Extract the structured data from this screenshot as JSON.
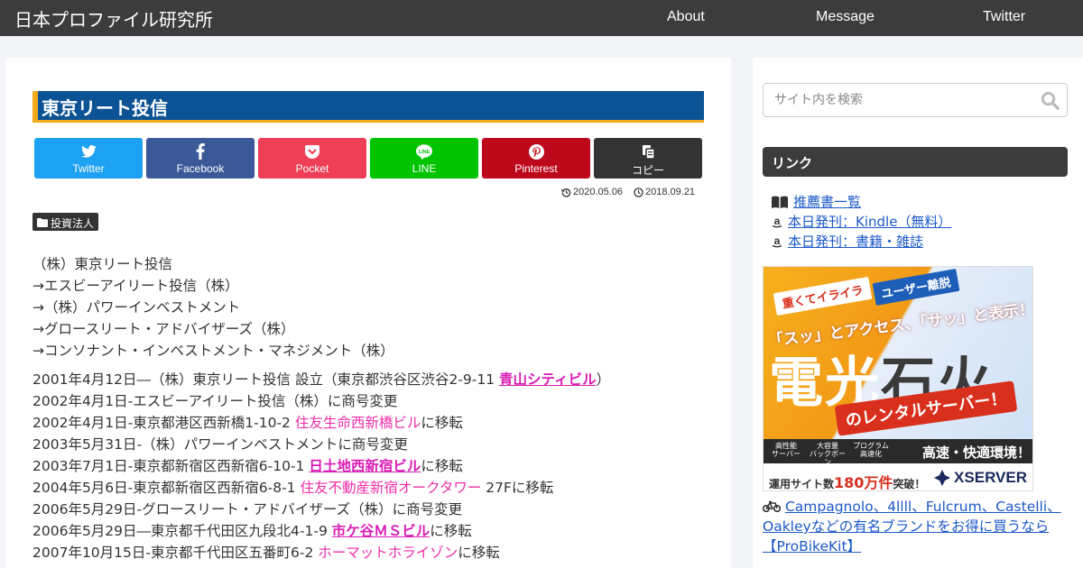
{
  "header": {
    "site_title": "日本プロファイル研究所",
    "nav": [
      "About",
      "Message",
      "Twitter"
    ]
  },
  "article": {
    "title": "東京リート投信",
    "share_buttons": [
      {
        "label": "Twitter",
        "color": "#1da1f2",
        "icon": "twitter-icon"
      },
      {
        "label": "Facebook",
        "color": "#3b5998",
        "icon": "facebook-icon"
      },
      {
        "label": "Pocket",
        "color": "#ef3f56",
        "icon": "pocket-icon"
      },
      {
        "label": "LINE",
        "color": "#00c300",
        "icon": "line-icon"
      },
      {
        "label": "Pinterest",
        "color": "#bd081c",
        "icon": "pinterest-icon"
      },
      {
        "label": "コピー",
        "color": "#333333",
        "icon": "copy-icon"
      }
    ],
    "updated_date": "2020.05.06",
    "published_date": "2018.09.21",
    "category": "投資法人",
    "name_history": [
      "（株）東京リート投信",
      "→エスビーアイリート投信（株）",
      "→（株）パワーインベストメント",
      "→グロースリート・アドバイザーズ（株）",
      "→コンソナント・インベストメント・マネジメント（株）"
    ],
    "timeline": [
      {
        "pre": "2001年4月12日―（株）東京リート投信 設立（東京都渋谷区渋谷2-9-11 ",
        "link": "青山シティビル",
        "link_style": "bold",
        "post": "）"
      },
      {
        "pre": "2002年4月1日-エスビーアイリート投信（株）に商号変更",
        "link": "",
        "link_style": "",
        "post": ""
      },
      {
        "pre": "2002年4月1日-東京都港区西新橋1-10-2 ",
        "link": "住友生命西新橋ビル",
        "link_style": "plain",
        "post": "に移転"
      },
      {
        "pre": "2003年5月31日-（株）パワーインベストメントに商号変更",
        "link": "",
        "link_style": "",
        "post": ""
      },
      {
        "pre": "2003年7月1日-東京都新宿区西新宿6-10-1 ",
        "link": "日土地西新宿ビル",
        "link_style": "bold",
        "post": "に移転"
      },
      {
        "pre": "2004年5月6日-東京都新宿区西新宿6-8-1 ",
        "link": "住友不動産新宿オークタワー",
        "link_style": "plain",
        "post": " 27Fに移転"
      },
      {
        "pre": "2006年5月29日-グロースリート・アドバイザーズ（株）に商号変更",
        "link": "",
        "link_style": "",
        "post": ""
      },
      {
        "pre": "2006年5月29日―東京都千代田区九段北4-1-9 ",
        "link": "市ケ谷ＭＳビル",
        "link_style": "bold",
        "post": "に移転"
      },
      {
        "pre": "2007年10月15日-東京都千代田区五番町6-2 ",
        "link": "ホーマットホライゾン",
        "link_style": "plain",
        "post": "に移転"
      }
    ],
    "colors": {
      "title_bg": "#0b5394",
      "title_accent": "#f4a91d",
      "link": "#ee2fa8"
    }
  },
  "sidebar": {
    "search_placeholder": "サイト内を検索",
    "widget_title": "リンク",
    "links": [
      {
        "icon": "book-icon",
        "text": "推薦書一覧"
      },
      {
        "icon": "amazon-icon",
        "text": "本日発刊：Kindle（無料）"
      },
      {
        "icon": "amazon-icon",
        "text": "本日発刊：書籍・雑誌"
      }
    ],
    "ad": {
      "band_1": "重くてイライラ",
      "band_2": "ユーザー離脱",
      "headline": "「スッ」とアクセス、「サッ」と表示！",
      "big_text_1": "電光",
      "big_text_2": "石火",
      "ribbon": "のレンタルサーバー！",
      "features": [
        "高性能\nサーバー",
        "大容量\nバックボーン",
        "プログラム\n高速化"
      ],
      "speed_text": "高速・快適環境！",
      "stat_pre": "運用サイト数",
      "stat_value": "180万件",
      "stat_post": "突破！",
      "brand": "XSERVER"
    },
    "bike_link": "Campagnolo、4llll、Fulcrum、Castelli、Oakleyなどの有名ブランドをお得に買うなら【ProBikeKit】"
  }
}
